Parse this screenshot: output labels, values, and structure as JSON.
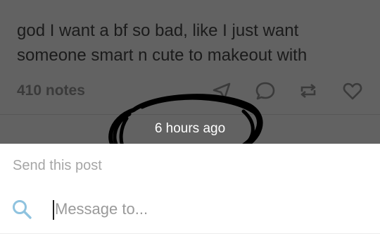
{
  "post": {
    "lines": [
      "god I want a bf so bad, like I just want",
      "someone smart n cute to makeout with"
    ],
    "notes": "410 notes",
    "actions": [
      "share-icon",
      "reply-icon",
      "reblog-icon",
      "like-icon"
    ]
  },
  "overlay": {
    "timestamp": "6 hours ago"
  },
  "share_sheet": {
    "title": "Send this post",
    "search": {
      "icon": "search-icon",
      "value": "",
      "placeholder": "Message to..."
    }
  },
  "colors": {
    "dim_overlay": "#626262",
    "search_icon": "#8fc3df",
    "scribble": "#000000"
  }
}
